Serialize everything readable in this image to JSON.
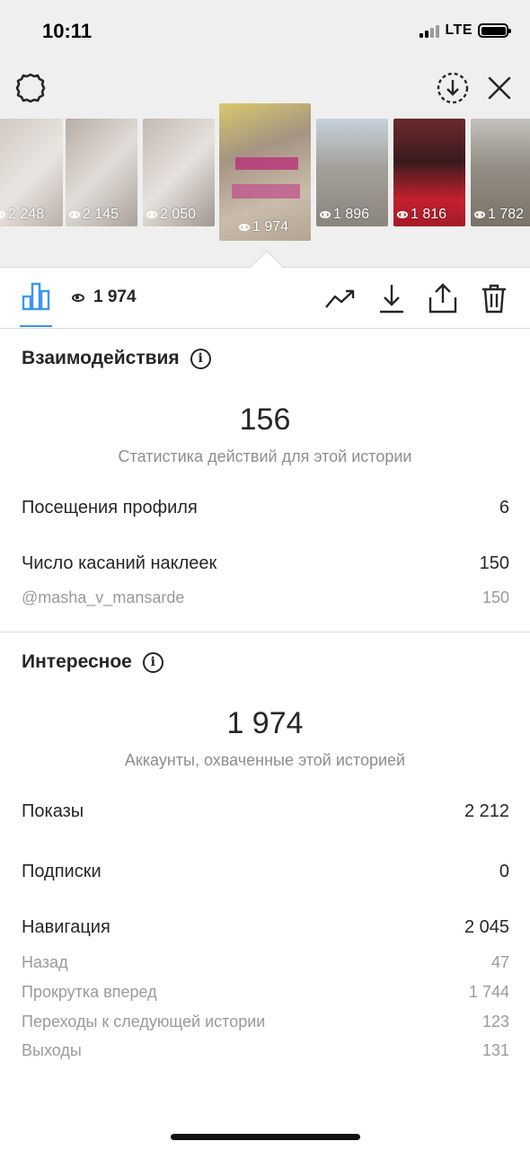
{
  "status_bar": {
    "time": "10:11",
    "network": "LTE"
  },
  "top_bar": {
    "icons": [
      "settings-icon",
      "save-download-icon",
      "close-icon"
    ]
  },
  "thumbnails": [
    {
      "views": "2 248",
      "selected": false,
      "colors": [
        "#c9c0b8",
        "#e8e4df"
      ]
    },
    {
      "views": "2 145",
      "selected": false,
      "colors": [
        "#b7ada5",
        "#dcd7d2"
      ]
    },
    {
      "views": "2 050",
      "selected": false,
      "colors": [
        "#bfb5ad",
        "#e0dad4"
      ]
    },
    {
      "views": "1 974",
      "selected": true,
      "colors": [
        "#a39382",
        "#d7cdbf"
      ],
      "handle": "@MASHA_V_MANSARDE"
    },
    {
      "views": "1 896",
      "selected": false,
      "colors": [
        "#8f8d8a",
        "#c9c6c1"
      ]
    },
    {
      "views": "1 816",
      "selected": false,
      "colors": [
        "#6b1e24",
        "#c4212f"
      ]
    },
    {
      "views": "1 782",
      "selected": false,
      "colors": [
        "#7f7a72",
        "#b6b1a8"
      ]
    }
  ],
  "tabs": {
    "views": "1 974",
    "actions": [
      "trend-icon",
      "download-icon",
      "share-icon",
      "trash-icon"
    ]
  },
  "interactions": {
    "title": "Взаимодействия",
    "total": "156",
    "subtitle": "Статистика действий для этой истории",
    "rows": [
      {
        "label": "Посещения профиля",
        "value": "6"
      },
      {
        "label": "Число касаний наклеек",
        "value": "150"
      }
    ],
    "sticker": {
      "label": "@masha_v_mansarde",
      "value": "150"
    }
  },
  "discovery": {
    "title": "Интересное",
    "total": "1 974",
    "subtitle": "Аккаунты, охваченные этой историей",
    "rows": [
      {
        "label": "Показы",
        "value": "2 212"
      },
      {
        "label": "Подписки",
        "value": "0"
      },
      {
        "label": "Навигация",
        "value": "2 045"
      }
    ],
    "navigation": [
      {
        "label": "Назад",
        "value": "47"
      },
      {
        "label": "Прокрутка вперед",
        "value": "1 744"
      },
      {
        "label": "Переходы к следующей истории",
        "value": "123"
      },
      {
        "label": "Выходы",
        "value": "131"
      }
    ]
  },
  "colors": {
    "accent": "#3897f0",
    "text": "#262626",
    "muted": "#8e8e8e",
    "header_bg": "#efefef"
  }
}
